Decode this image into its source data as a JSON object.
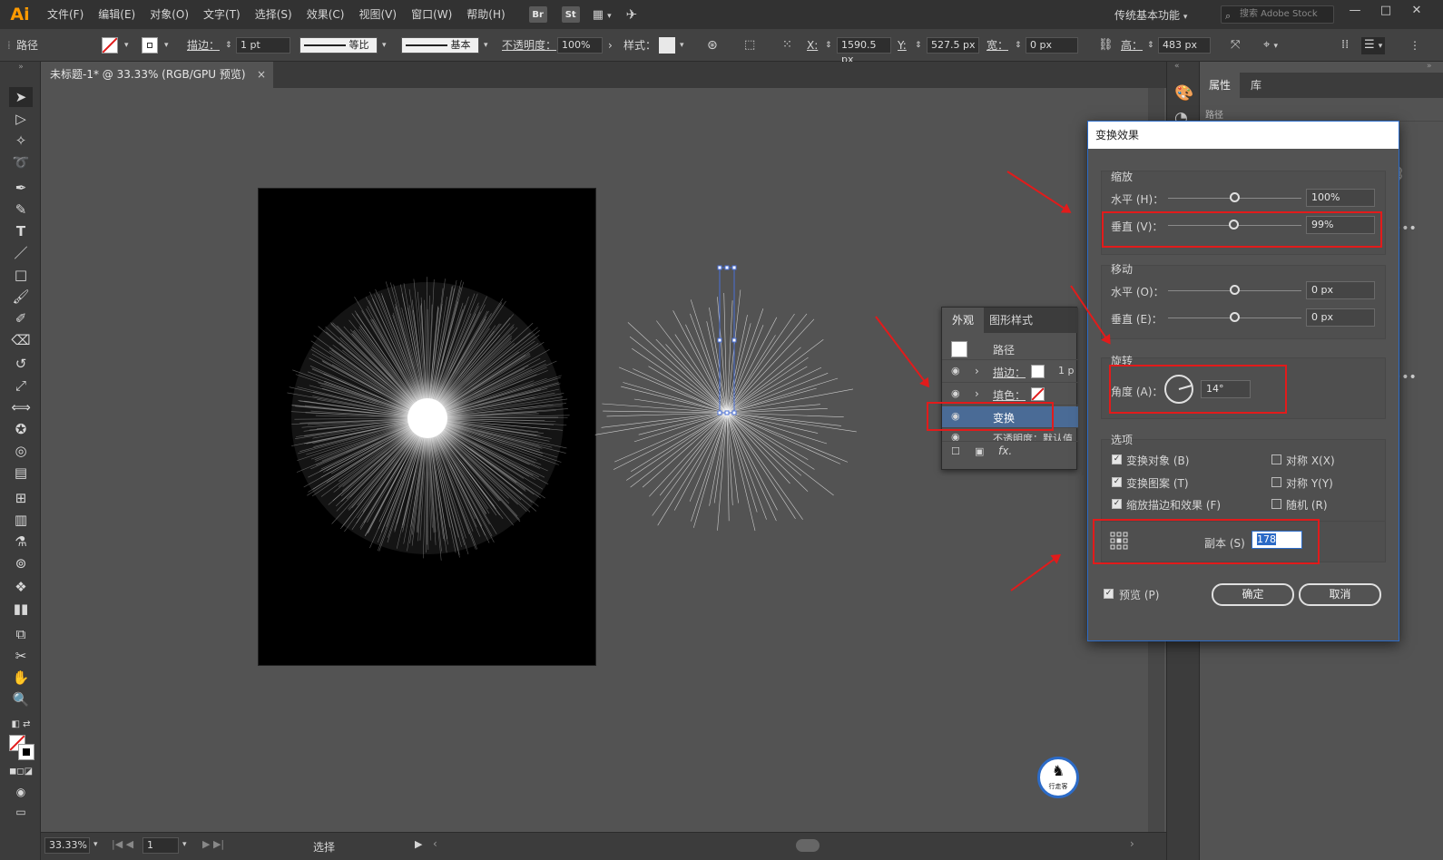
{
  "app": {
    "logo": "Ai"
  },
  "menu": [
    "文件(F)",
    "编辑(E)",
    "对象(O)",
    "文字(T)",
    "选择(S)",
    "效果(C)",
    "视图(V)",
    "窗口(W)",
    "帮助(H)"
  ],
  "menu_buttons": [
    "Br",
    "St"
  ],
  "workspace": "传统基本功能",
  "search_placeholder": "搜索 Adobe Stock",
  "control": {
    "selection": "路径",
    "stroke_label": "描边：",
    "stroke_weight": "1 pt",
    "profile_label": "等比",
    "brush_label": "基本",
    "opacity_label": "不透明度：",
    "opacity_value": "100%",
    "style_label": "样式：",
    "x_label": "X:",
    "x_value": "1590.5 px",
    "y_label": "Y:",
    "y_value": "527.5 px",
    "w_label": "宽：",
    "w_value": "0 px",
    "h_label": "高：",
    "h_value": "483 px"
  },
  "doc_tab": {
    "title": "未标题-1* @ 33.33% (RGB/GPU 预览)",
    "close": "×"
  },
  "status": {
    "zoom": "33.33%",
    "page": "1",
    "tool": "选择"
  },
  "props_panel": {
    "tab_props": "属性",
    "tab_lib": "库",
    "selection": "路径"
  },
  "appearance": {
    "tab_appearance": "外观",
    "tab_styles": "图形样式",
    "path_label": "路径",
    "stroke_label": "描边：",
    "stroke_value": "1 p",
    "fill_label": "填色：",
    "transform_label": "变换",
    "opacity_label": "不透明度：默认值",
    "fx": "fx."
  },
  "dialog": {
    "title": "变换效果",
    "scale_group": "缩放",
    "scale_h_label": "水平 (H)：",
    "scale_h_value": "100%",
    "scale_v_label": "垂直 (V)：",
    "scale_v_value": "99%",
    "move_group": "移动",
    "move_h_label": "水平 (O)：",
    "move_h_value": "0 px",
    "move_v_label": "垂直 (E)：",
    "move_v_value": "0 px",
    "rotate_group": "旋转",
    "angle_label": "角度 (A)：",
    "angle_value": "14°",
    "options_group": "选项",
    "opt_transform_objects": "变换对象 (B)",
    "opt_transform_patterns": "变换图案 (T)",
    "opt_scale_strokes": "缩放描边和效果 (F)",
    "opt_reflect_x": "对称 X(X)",
    "opt_reflect_y": "对称 Y(Y)",
    "opt_random": "随机 (R)",
    "copies_label": "副本 (S)",
    "copies_value": "178",
    "preview_label": "预览 (P)",
    "ok": "确定",
    "cancel": "取消"
  },
  "watermark_text": "行走客",
  "colors": {
    "accent": "#2c6bc7",
    "highlight": "#e21b1b",
    "logo": "#ff9a00"
  }
}
